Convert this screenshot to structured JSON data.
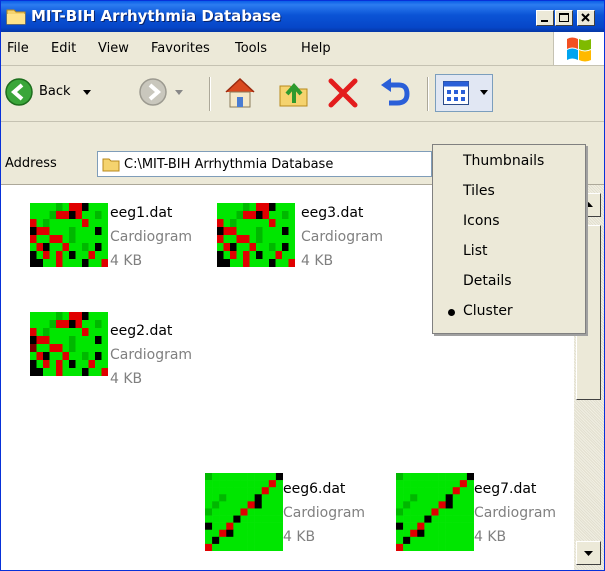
{
  "window": {
    "title": "MIT-BIH Arrhythmia Database",
    "controls": [
      "minimize",
      "maximize",
      "close"
    ]
  },
  "menubar": {
    "items": [
      "File",
      "Edit",
      "View",
      "Favorites",
      "Tools",
      "Help"
    ]
  },
  "toolbar": {
    "back_label": "Back",
    "buttons": [
      "back",
      "forward",
      "home",
      "up",
      "delete",
      "undo",
      "views"
    ]
  },
  "address": {
    "label": "Address",
    "value": "C:\\MIT-BIH Arrhythmia Database"
  },
  "files": [
    {
      "name": "eeg1.dat",
      "type": "Cardiogram",
      "size": "4 KB"
    },
    {
      "name": "eeg3.dat",
      "type": "Cardiogram",
      "size": "4 KB"
    },
    {
      "name": "eeg2.dat",
      "type": "Cardiogram",
      "size": "4 KB"
    },
    {
      "name": "eeg6.dat",
      "type": "Cardiogram",
      "size": "4 KB"
    },
    {
      "name": "eeg7.dat",
      "type": "Cardiogram",
      "size": "4 KB"
    }
  ],
  "views_menu": {
    "items": [
      "Thumbnails",
      "Tiles",
      "Icons",
      "List",
      "Details",
      "Cluster"
    ],
    "selected": "Cluster"
  },
  "colors": {
    "titlebar": "#0b54d6",
    "thumb_green": "#00e600",
    "thumb_red": "#e00000",
    "thumb_black": "#000000"
  }
}
